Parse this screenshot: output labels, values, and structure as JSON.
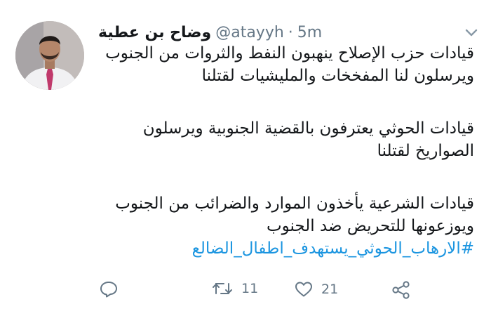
{
  "author": {
    "display_name": "وضاح بن عطية",
    "handle": "@atayyh",
    "separator": "·",
    "time": "5m"
  },
  "tweet": {
    "paragraphs": [
      [
        "قيادات حزب الإصلاح ينهبون النفط والثروات من الجنوب",
        "ويرسلون لنا المفخخات والمليشيات لقتلنا"
      ],
      [
        "قيادات الحوثي يعترفون بالقضية الجنوبية ويرسلون",
        "الصواريخ لقتلنا"
      ],
      [
        "قيادات الشرعية يأخذون الموارد والضرائب من الجنوب",
        "ويوزعونها للتحريض ضد الجنوب"
      ]
    ],
    "hashtag": "#الارهاب_الحوثي_يستهدف_اطفال_الضالع"
  },
  "actions": {
    "reply": {
      "icon": "reply-icon",
      "count": ""
    },
    "retweet": {
      "icon": "retweet-icon",
      "count": "11"
    },
    "like": {
      "icon": "heart-icon",
      "count": "21"
    },
    "share": {
      "icon": "share-icon"
    },
    "menu": {
      "icon": "chevron-down-icon"
    }
  },
  "colors": {
    "text": "#14171a",
    "muted": "#657786",
    "link": "#1b95e0",
    "background": "#ffffff"
  }
}
